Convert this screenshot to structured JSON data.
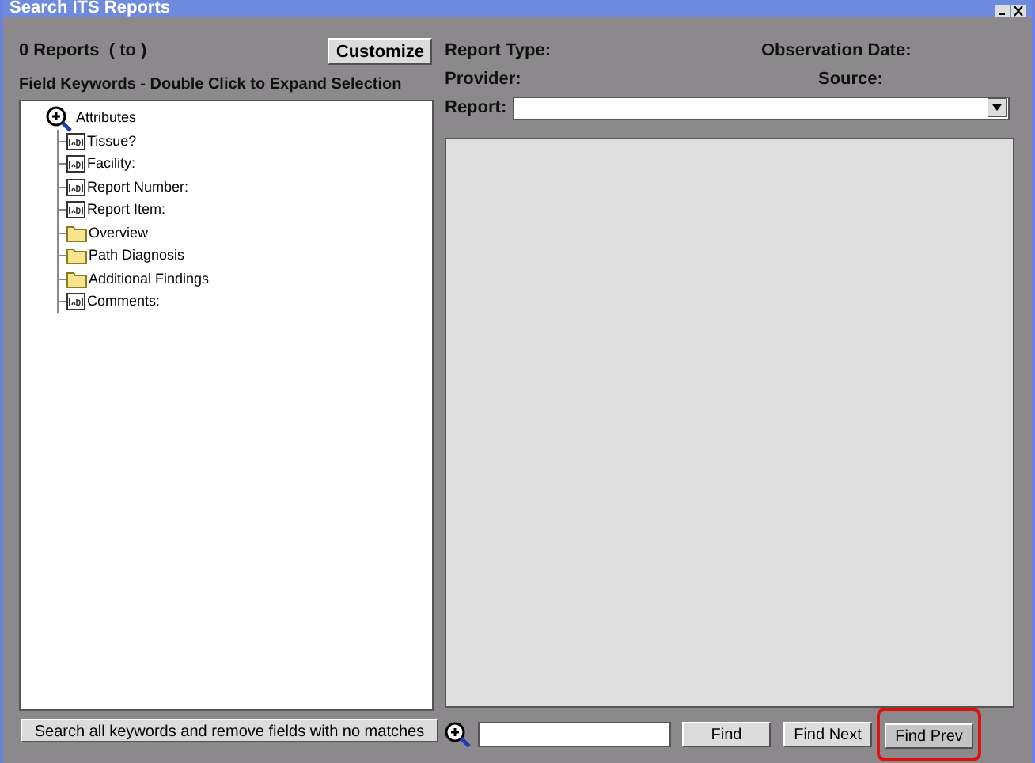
{
  "window": {
    "title": "Search ITS Reports"
  },
  "left": {
    "report_count": "0 Reports  ( to )",
    "customize_button": "Customize",
    "keywords_label": "Field Keywords - Double Click to Expand Selection",
    "tree": {
      "label": "Attributes",
      "children": [
        {
          "kind": "field",
          "label": "Tissue?"
        },
        {
          "kind": "field",
          "label": "Facility:"
        },
        {
          "kind": "field",
          "label": "Report Number:"
        },
        {
          "kind": "field",
          "label": "Report Item:"
        },
        {
          "kind": "folder",
          "label": "Overview"
        },
        {
          "kind": "folder",
          "label": "Path Diagnosis"
        },
        {
          "kind": "folder",
          "label": "Additional Findings"
        },
        {
          "kind": "field",
          "label": "Comments:"
        }
      ]
    },
    "search_all_button": "Search all keywords and remove fields with no matches"
  },
  "right": {
    "report_type_label": "Report Type:",
    "observation_date_label": "Observation Date:",
    "provider_label": "Provider:",
    "source_label": "Source:",
    "report_label": "Report:",
    "find_buttons": [
      {
        "label": "Find",
        "highlighted": false
      },
      {
        "label": "Find Next",
        "highlighted": false
      },
      {
        "label": "Find Prev",
        "highlighted": true
      }
    ]
  }
}
